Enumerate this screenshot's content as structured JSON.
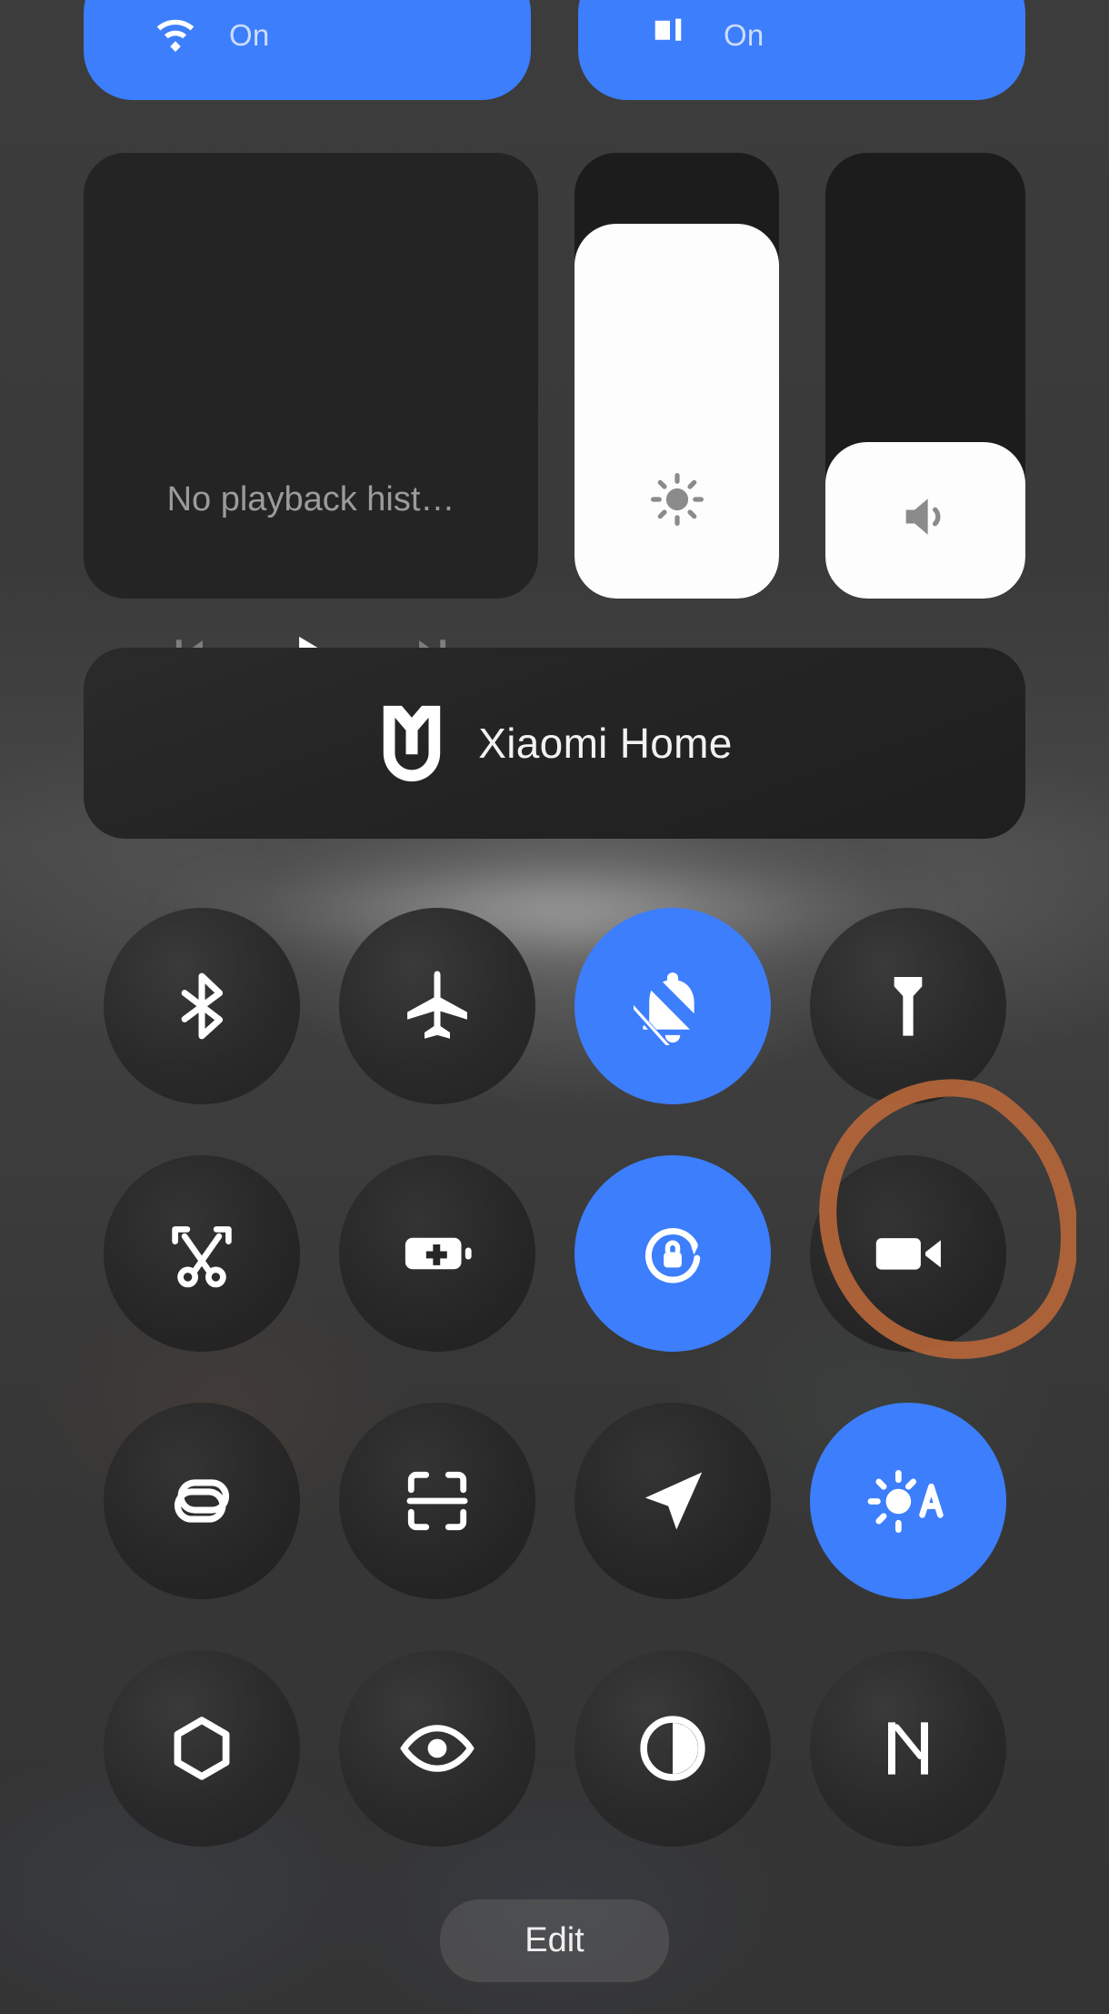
{
  "accent_color": "#3c7efc",
  "panel_bg": "#3b3b3b",
  "tile_bg": "#242424",
  "annotation_color": "#b5663a",
  "connectivity": {
    "tiles": [
      {
        "name": "wifi",
        "icon": "wifi-icon",
        "status": "On",
        "active": true
      },
      {
        "name": "mobile-data",
        "icon": "mobile-data-icon",
        "status": "On",
        "active": true
      }
    ]
  },
  "media": {
    "title": "No playback hist…",
    "controls": [
      {
        "name": "previous",
        "icon": "skip-previous-icon",
        "enabled": false
      },
      {
        "name": "play",
        "icon": "play-icon",
        "enabled": true
      },
      {
        "name": "next",
        "icon": "skip-next-icon",
        "enabled": false
      }
    ]
  },
  "sliders": [
    {
      "name": "brightness",
      "icon": "brightness-sun-icon",
      "level_percent": 84
    },
    {
      "name": "volume",
      "icon": "volume-speaker-icon",
      "level_percent": 35
    }
  ],
  "home_card": {
    "label": "Xiaomi Home",
    "icon": "mijia-shield-icon"
  },
  "toggles": [
    {
      "name": "bluetooth",
      "icon": "bluetooth-icon",
      "active": false
    },
    {
      "name": "airplane-mode",
      "icon": "airplane-icon",
      "active": false
    },
    {
      "name": "silent-mode",
      "icon": "bell-muted-icon",
      "active": true
    },
    {
      "name": "flashlight",
      "icon": "flashlight-icon",
      "active": false
    },
    {
      "name": "screenshot",
      "icon": "scissors-crop-icon",
      "active": false
    },
    {
      "name": "battery-saver",
      "icon": "battery-plus-icon",
      "active": false
    },
    {
      "name": "rotation-lock",
      "icon": "rotation-lock-icon",
      "active": true
    },
    {
      "name": "screen-recorder",
      "icon": "video-camera-icon",
      "active": false,
      "annotated": true
    },
    {
      "name": "cast-link",
      "icon": "link-chain-icon",
      "active": false
    },
    {
      "name": "scan-code",
      "icon": "scan-frame-icon",
      "active": false
    },
    {
      "name": "location",
      "icon": "location-arrow-icon",
      "active": false
    },
    {
      "name": "auto-brightness",
      "icon": "auto-brightness-icon",
      "active": true
    },
    {
      "name": "camera-shortcut",
      "icon": "hexagon-aperture-icon",
      "active": false
    },
    {
      "name": "eye-comfort",
      "icon": "eye-icon",
      "active": false
    },
    {
      "name": "dark-mode",
      "icon": "contrast-circle-icon",
      "active": false
    },
    {
      "name": "nfc",
      "icon": "nfc-icon",
      "active": false
    }
  ],
  "footer": {
    "edit_label": "Edit"
  }
}
